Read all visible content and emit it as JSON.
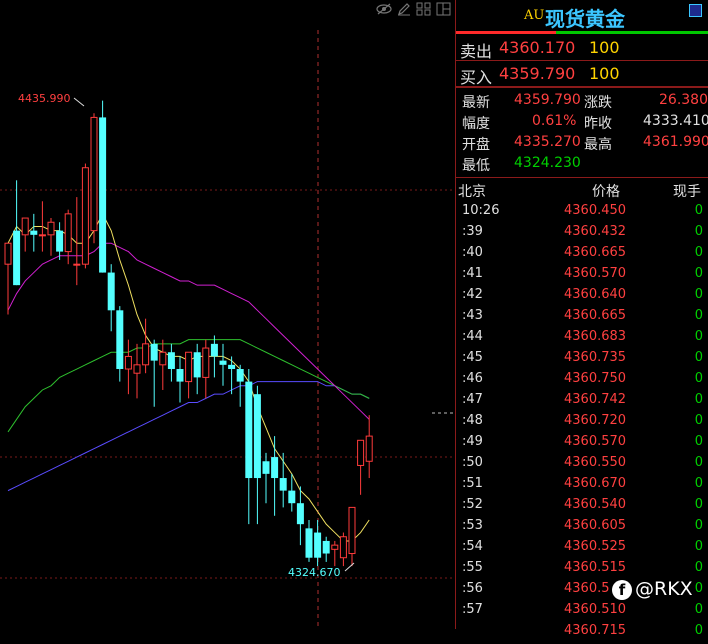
{
  "chart": {
    "high_label": "4435.990",
    "low_label": "4324.670",
    "candles": [
      {
        "o": 4397,
        "h": 4402,
        "l": 4385,
        "c": 4402
      },
      {
        "o": 4405,
        "h": 4417,
        "l": 4392,
        "c": 4392
      },
      {
        "o": 4404,
        "h": 4408,
        "l": 4400,
        "c": 4408
      },
      {
        "o": 4405,
        "h": 4409,
        "l": 4400,
        "c": 4404
      },
      {
        "o": 4404,
        "h": 4412,
        "l": 4400,
        "c": 4404
      },
      {
        "o": 4404,
        "h": 4408,
        "l": 4399,
        "c": 4407
      },
      {
        "o": 4405,
        "h": 4407,
        "l": 4398,
        "c": 4400
      },
      {
        "o": 4400,
        "h": 4410,
        "l": 4397,
        "c": 4409
      },
      {
        "o": 4397,
        "h": 4413,
        "l": 4392,
        "c": 4397
      },
      {
        "o": 4397,
        "h": 4421,
        "l": 4396,
        "c": 4420
      },
      {
        "o": 4405,
        "h": 4433,
        "l": 4402,
        "c": 4432
      },
      {
        "o": 4432,
        "h": 4436,
        "l": 4395,
        "c": 4395
      },
      {
        "o": 4395,
        "h": 4397,
        "l": 4381,
        "c": 4386
      },
      {
        "o": 4386,
        "h": 4387,
        "l": 4369,
        "c": 4372
      },
      {
        "o": 4372,
        "h": 4379,
        "l": 4366,
        "c": 4375
      },
      {
        "o": 4371,
        "h": 4378,
        "l": 4365,
        "c": 4373
      },
      {
        "o": 4373,
        "h": 4384,
        "l": 4371,
        "c": 4378
      },
      {
        "o": 4378,
        "h": 4379,
        "l": 4363,
        "c": 4374
      },
      {
        "o": 4373,
        "h": 4379,
        "l": 4367,
        "c": 4376
      },
      {
        "o": 4376,
        "h": 4378,
        "l": 4369,
        "c": 4372
      },
      {
        "o": 4372,
        "h": 4375,
        "l": 4364,
        "c": 4369
      },
      {
        "o": 4369,
        "h": 4376,
        "l": 4365,
        "c": 4376
      },
      {
        "o": 4376,
        "h": 4378,
        "l": 4366,
        "c": 4370
      },
      {
        "o": 4370,
        "h": 4379,
        "l": 4365,
        "c": 4377
      },
      {
        "o": 4378,
        "h": 4380,
        "l": 4370,
        "c": 4375
      },
      {
        "o": 4374,
        "h": 4378,
        "l": 4368,
        "c": 4373
      },
      {
        "o": 4373,
        "h": 4375,
        "l": 4366,
        "c": 4372
      },
      {
        "o": 4372,
        "h": 4373,
        "l": 4363,
        "c": 4369
      },
      {
        "o": 4369,
        "h": 4372,
        "l": 4335,
        "c": 4346
      },
      {
        "o": 4366,
        "h": 4368,
        "l": 4335,
        "c": 4346
      },
      {
        "o": 4350,
        "h": 4352,
        "l": 4340,
        "c": 4347
      },
      {
        "o": 4351,
        "h": 4356,
        "l": 4337,
        "c": 4346
      },
      {
        "o": 4346,
        "h": 4352,
        "l": 4339,
        "c": 4343
      },
      {
        "o": 4343,
        "h": 4347,
        "l": 4338,
        "c": 4340
      },
      {
        "o": 4340,
        "h": 4344,
        "l": 4330,
        "c": 4335
      },
      {
        "o": 4334,
        "h": 4336,
        "l": 4326,
        "c": 4327
      },
      {
        "o": 4333,
        "h": 4336,
        "l": 4325,
        "c": 4327
      },
      {
        "o": 4331,
        "h": 4332,
        "l": 4326,
        "c": 4328
      },
      {
        "o": 4329,
        "h": 4331,
        "l": 4325,
        "c": 4330
      },
      {
        "o": 4327,
        "h": 4333,
        "l": 4325,
        "c": 4332
      },
      {
        "o": 4328,
        "h": 4339,
        "l": 4325,
        "c": 4339
      },
      {
        "o": 4349,
        "h": 4355,
        "l": 4342,
        "c": 4355
      },
      {
        "o": 4350,
        "h": 4361,
        "l": 4346,
        "c": 4356
      }
    ],
    "ma_yellow": [
      4402,
      4406,
      4404,
      4406,
      4406,
      4405,
      4405,
      4404,
      4402,
      4402,
      4405,
      4409,
      4405,
      4398,
      4392,
      4385,
      4380,
      4377,
      4376,
      4375,
      4375,
      4374,
      4375,
      4375,
      4375,
      4375,
      4374,
      4372,
      4369,
      4363,
      4358,
      4353,
      4350,
      4347,
      4343,
      4341,
      4338,
      4335,
      4333,
      4331,
      4331,
      4333,
      4336
    ],
    "ma_magenta": [
      4386,
      4390,
      4393,
      4395,
      4397,
      4398,
      4399,
      4399,
      4399,
      4399,
      4400,
      4402,
      4402,
      4401,
      4400,
      4398,
      4397,
      4396,
      4395,
      4394,
      4393,
      4393,
      4392,
      4392,
      4392,
      4391,
      4390,
      4389,
      4388,
      4386,
      4384,
      4382,
      4380,
      4378,
      4376,
      4374,
      4372,
      4370,
      4368,
      4366,
      4364,
      4362,
      4360
    ],
    "ma_green": [
      4357,
      4360,
      4363,
      4365,
      4367,
      4368,
      4370,
      4371,
      4372,
      4373,
      4374,
      4375,
      4376,
      4376,
      4376,
      4377,
      4377,
      4378,
      4378,
      4378,
      4378,
      4379,
      4379,
      4379,
      4379,
      4379,
      4379,
      4379,
      4378,
      4377,
      4376,
      4375,
      4374,
      4373,
      4372,
      4371,
      4370,
      4369,
      4368,
      4367,
      4366,
      4366,
      4365
    ],
    "ma_blue": [
      4343,
      4344,
      4345,
      4346,
      4347,
      4348,
      4349,
      4350,
      4351,
      4352,
      4353,
      4354,
      4355,
      4356,
      4357,
      4358,
      4359,
      4360,
      4361,
      4362,
      4363,
      4364,
      4364,
      4365,
      4366,
      4366,
      4367,
      4368,
      4368,
      4369,
      4369,
      4369,
      4369,
      4369,
      4369,
      4369,
      4369,
      4368,
      4368,
      4367,
      4366,
      4366,
      4365
    ],
    "ylim": [
      4310,
      4460
    ]
  },
  "panel": {
    "code": "AU",
    "name": "现货黄金",
    "sell_label": "卖出",
    "sell_price": "4360.170",
    "sell_vol": "100",
    "buy_label": "买入",
    "buy_price": "4359.790",
    "buy_vol": "100",
    "stats": {
      "latest_k": "最新",
      "latest_v": "4359.790",
      "change_k": "涨跌",
      "change_v": "26.380",
      "amp_k": "幅度",
      "amp_v": "0.61%",
      "prev_k": "昨收",
      "prev_v": "4333.410",
      "open_k": "开盘",
      "open_v": "4335.270",
      "high_k": "最高",
      "high_v": "4361.990",
      "low_k": "最低",
      "low_v": "4324.230"
    },
    "table_head": {
      "time": "北京",
      "price": "价格",
      "vol": "现手"
    },
    "ticks": [
      {
        "t": "10:26",
        "p": "4360.450",
        "v": "0"
      },
      {
        "t": ":39",
        "p": "4360.432",
        "v": "0"
      },
      {
        "t": ":40",
        "p": "4360.665",
        "v": "0"
      },
      {
        "t": ":41",
        "p": "4360.570",
        "v": "0"
      },
      {
        "t": ":42",
        "p": "4360.640",
        "v": "0"
      },
      {
        "t": ":43",
        "p": "4360.665",
        "v": "0"
      },
      {
        "t": ":44",
        "p": "4360.683",
        "v": "0"
      },
      {
        "t": ":45",
        "p": "4360.735",
        "v": "0"
      },
      {
        "t": ":46",
        "p": "4360.750",
        "v": "0"
      },
      {
        "t": ":47",
        "p": "4360.742",
        "v": "0"
      },
      {
        "t": ":48",
        "p": "4360.720",
        "v": "0"
      },
      {
        "t": ":49",
        "p": "4360.570",
        "v": "0"
      },
      {
        "t": ":50",
        "p": "4360.550",
        "v": "0"
      },
      {
        "t": ":51",
        "p": "4360.670",
        "v": "0"
      },
      {
        "t": ":52",
        "p": "4360.540",
        "v": "0"
      },
      {
        "t": ":53",
        "p": "4360.605",
        "v": "0"
      },
      {
        "t": ":54",
        "p": "4360.525",
        "v": "0"
      },
      {
        "t": ":55",
        "p": "4360.515",
        "v": "0"
      },
      {
        "t": ":56",
        "p": "4360.5",
        "v": "0"
      },
      {
        "t": ":57",
        "p": "4360.510",
        "v": "0"
      },
      {
        "t": "",
        "p": "4360.715",
        "v": "0"
      }
    ]
  },
  "watermark": {
    "logo": "f",
    "text": "@RKX"
  }
}
